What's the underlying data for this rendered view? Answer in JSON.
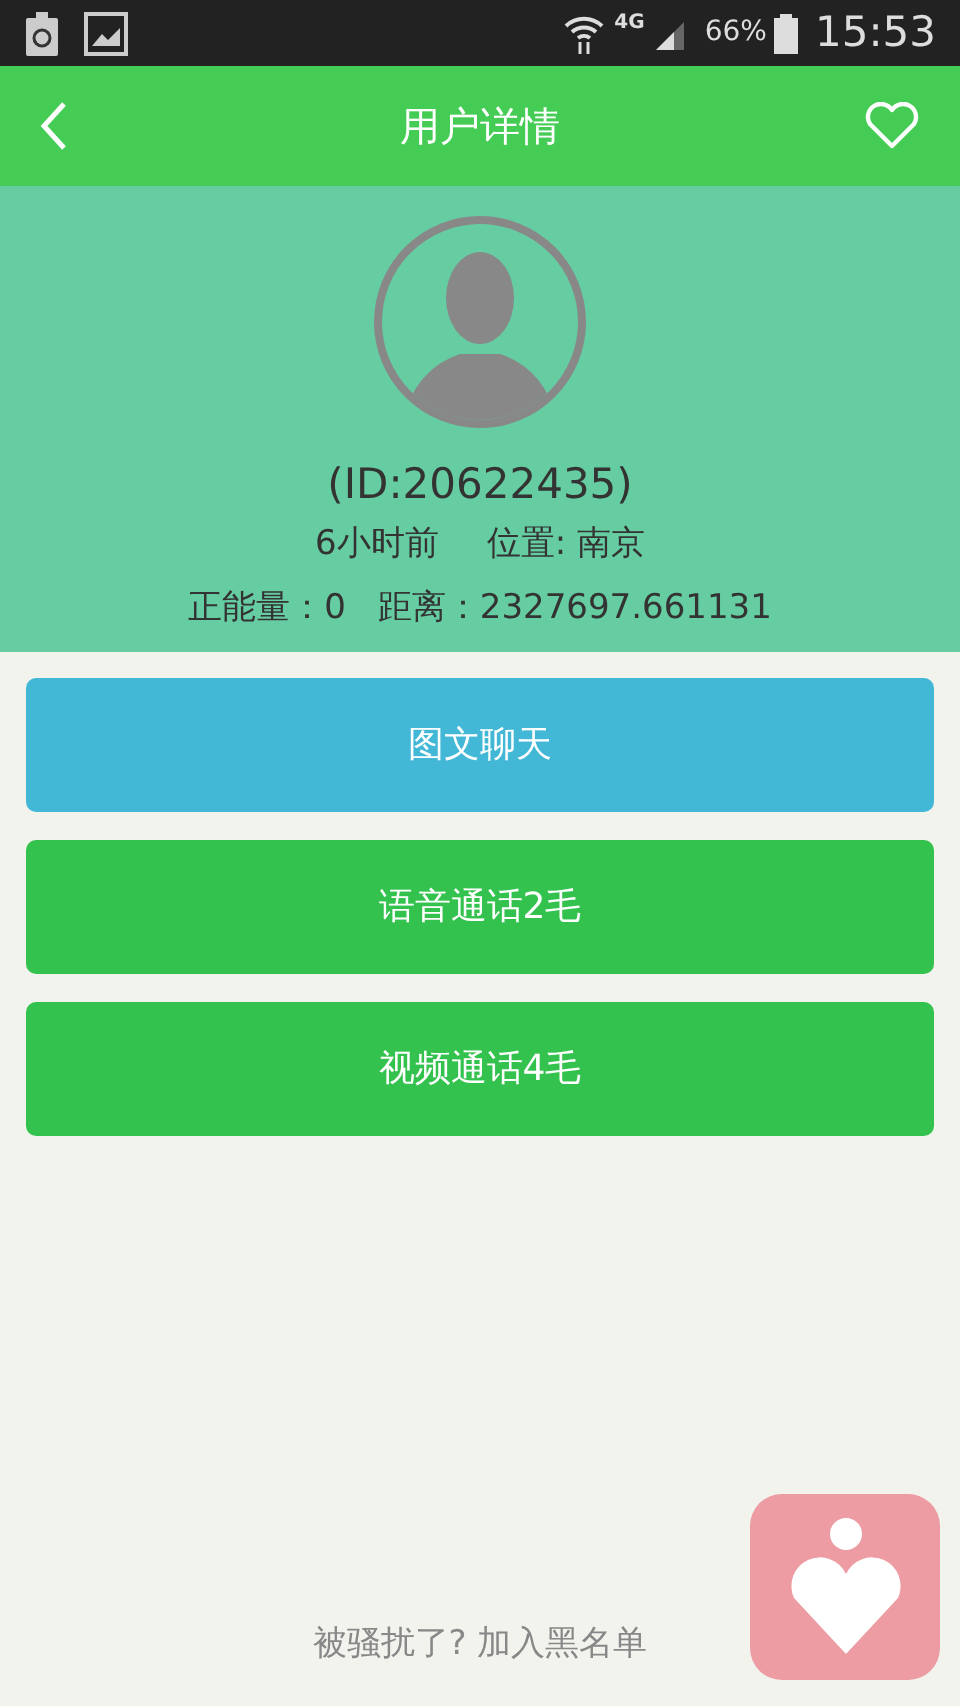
{
  "status_bar": {
    "network": "4G",
    "battery": "66%",
    "time": "15:53"
  },
  "header": {
    "title": "用户详情"
  },
  "profile": {
    "id": "(ID:20622435)",
    "last_seen": "6小时前",
    "location": "位置: 南京",
    "energy": "正能量：0",
    "distance": "距离：2327697.661131"
  },
  "actions": [
    {
      "label": "图文聊天",
      "color": "#42b8d6"
    },
    {
      "label": "语音通话2毛",
      "color": "#33c24d"
    },
    {
      "label": "视频通话4毛",
      "color": "#33c24d"
    }
  ],
  "footer": {
    "link": "被骚扰了? 加入黑名单"
  }
}
